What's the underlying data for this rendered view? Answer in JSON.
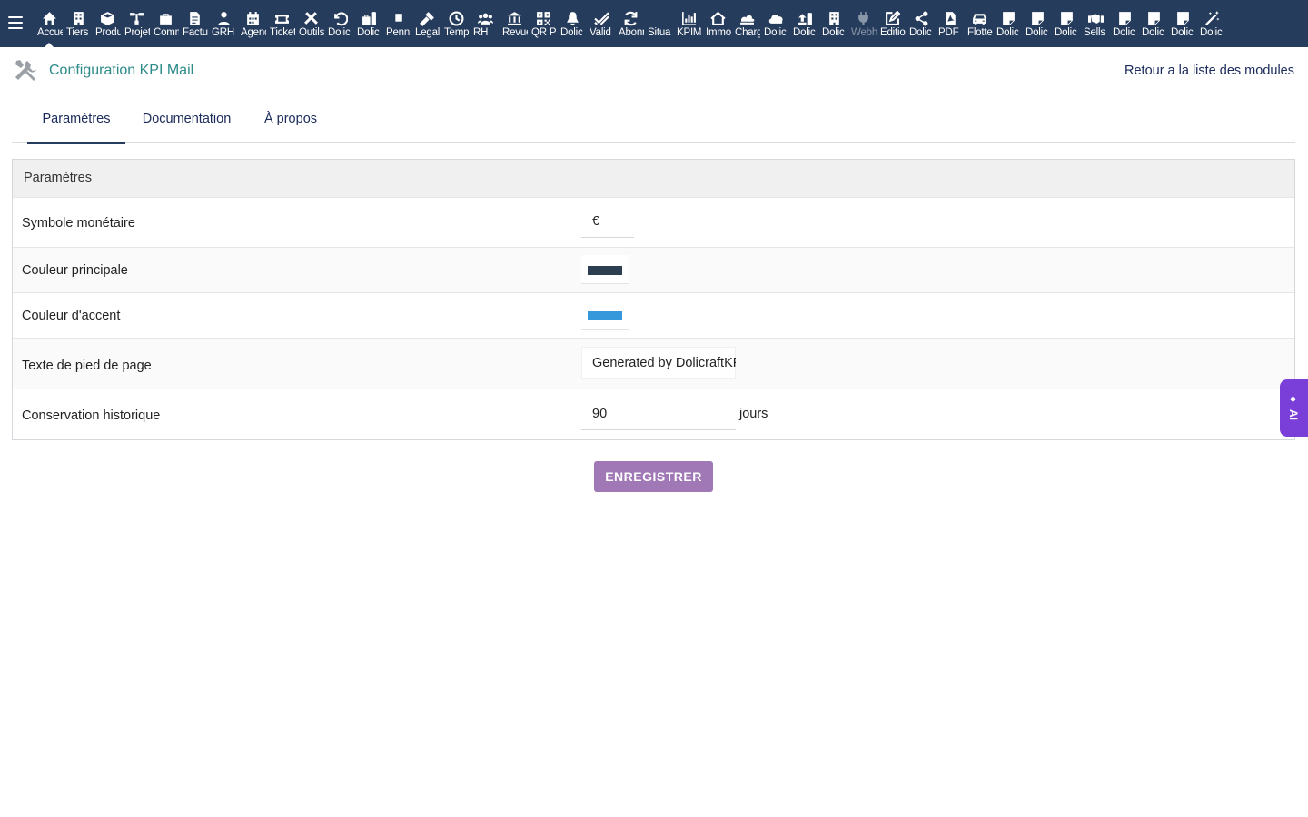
{
  "topnav": {
    "items": [
      {
        "label": "Accueil",
        "icon": "home-icon"
      },
      {
        "label": "Tiers",
        "icon": "building-icon"
      },
      {
        "label": "Produits",
        "icon": "cube-icon"
      },
      {
        "label": "Projets",
        "icon": "sitemap-icon"
      },
      {
        "label": "Commerce",
        "icon": "briefcase-icon"
      },
      {
        "label": "Facturation",
        "icon": "invoice-icon"
      },
      {
        "label": "GRH",
        "icon": "users-icon"
      },
      {
        "label": "Agenda",
        "icon": "calendar-icon"
      },
      {
        "label": "Tickets",
        "icon": "ticket-icon"
      },
      {
        "label": "Outils",
        "icon": "tools-icon"
      },
      {
        "label": "Dolic",
        "icon": "undo-icon"
      },
      {
        "label": "Dolic",
        "icon": "toolbox-icon"
      },
      {
        "label": "Penn",
        "icon": "file-icon"
      },
      {
        "label": "Legal",
        "icon": "gavel-icon"
      },
      {
        "label": "Temps",
        "icon": "clock-icon"
      },
      {
        "label": "RH",
        "icon": "team-icon"
      },
      {
        "label": "Revue",
        "icon": "bank-icon"
      },
      {
        "label": "QR Pay",
        "icon": "qrcode-icon"
      },
      {
        "label": "Dolic",
        "icon": "bell-icon"
      },
      {
        "label": "Valid",
        "icon": "check-double-icon"
      },
      {
        "label": "Abonnements",
        "icon": "refresh-icon"
      },
      {
        "label": "Situa",
        "icon": "blank-icon"
      },
      {
        "label": "KPIM",
        "icon": "bar-chart-icon"
      },
      {
        "label": "Immo",
        "icon": "house-icon"
      },
      {
        "label": "Charges",
        "icon": "cloud-stack-icon"
      },
      {
        "label": "Dolic",
        "icon": "cloud-icon"
      },
      {
        "label": "Dolic",
        "icon": "upload-icon"
      },
      {
        "label": "Dolic",
        "icon": "office-icon"
      },
      {
        "label": "Webhook",
        "icon": "plug-icon"
      },
      {
        "label": "Edition",
        "icon": "edit-icon"
      },
      {
        "label": "Dolic",
        "icon": "share-icon"
      },
      {
        "label": "PDF",
        "icon": "pdf-icon"
      },
      {
        "label": "Flotte",
        "icon": "car-icon"
      },
      {
        "label": "Dolic",
        "icon": "note-icon"
      },
      {
        "label": "Dolic",
        "icon": "note-icon"
      },
      {
        "label": "Dolic",
        "icon": "note-icon"
      },
      {
        "label": "Sells",
        "icon": "handshake-icon"
      },
      {
        "label": "Dolic",
        "icon": "note-icon"
      },
      {
        "label": "Dolic",
        "icon": "note-icon"
      },
      {
        "label": "Dolic",
        "icon": "note-icon"
      },
      {
        "label": "Dolic",
        "icon": "magic-wand-icon"
      }
    ]
  },
  "header": {
    "title": "Configuration KPI Mail",
    "back_link": "Retour a la liste des modules"
  },
  "tabs": [
    {
      "label": "Paramètres"
    },
    {
      "label": "Documentation"
    },
    {
      "label": "À propos"
    }
  ],
  "params": {
    "section_title": "Paramètres",
    "currency": {
      "label": "Symbole monétaire",
      "value": "€"
    },
    "primary_color": {
      "label": "Couleur principale",
      "value": "#2c3e50"
    },
    "accent_color": {
      "label": "Couleur d'accent",
      "value": "#3498db"
    },
    "footer_text": {
      "label": "Texte de pied de page",
      "value": "Generated by DolicraftKPI Mail"
    },
    "retention": {
      "label": "Conservation historique",
      "value": "90",
      "unit": "jours"
    }
  },
  "actions": {
    "save_label": "ENREGISTRER"
  },
  "ai_widget": {
    "label": "AI"
  }
}
